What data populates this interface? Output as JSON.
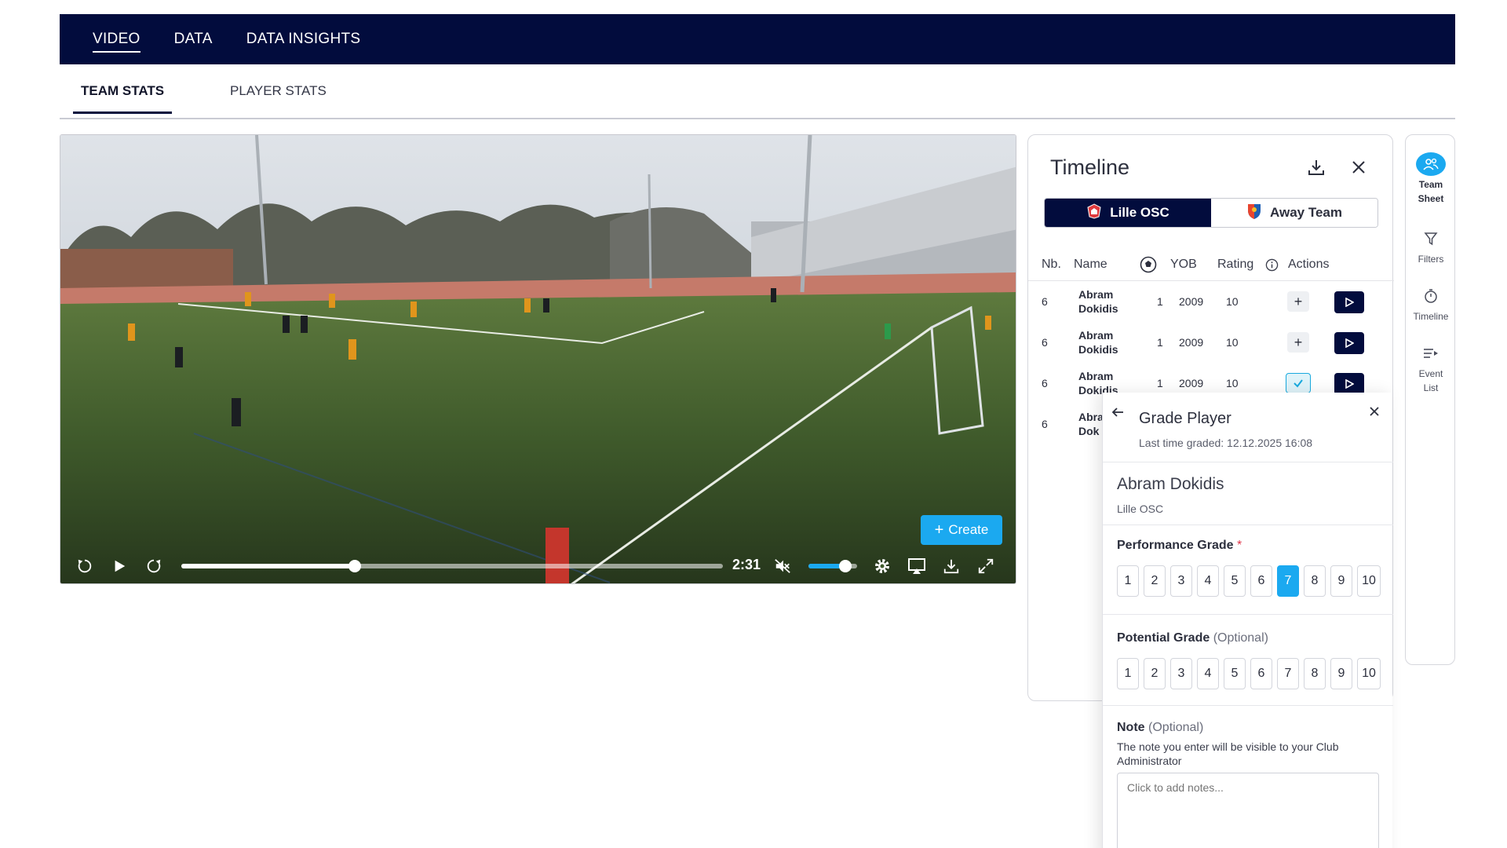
{
  "topnav": {
    "items": [
      {
        "label": "VIDEO",
        "active": true
      },
      {
        "label": "DATA",
        "active": false
      },
      {
        "label": "DATA INSIGHTS",
        "active": false
      }
    ]
  },
  "subtabs": [
    {
      "label": "TEAM STATS",
      "active": true
    },
    {
      "label": "PLAYER STATS",
      "active": false
    }
  ],
  "video": {
    "create_label": "Create",
    "time": "2:31",
    "progress_fraction": 0.32,
    "volume_fraction": 0.75,
    "muted_icon": "volume-muted-icon"
  },
  "timeline": {
    "title": "Timeline",
    "teams": [
      {
        "label": "Lille OSC",
        "active": true
      },
      {
        "label": "Away Team",
        "active": false
      }
    ],
    "headers": {
      "nb": "Nb.",
      "name": "Name",
      "yob": "YOB",
      "rating": "Rating",
      "actions": "Actions"
    },
    "rows": [
      {
        "nb": "6",
        "first": "Abram",
        "last": "Dokidis",
        "goals": "1",
        "yob": "2009",
        "rating": "10",
        "checked": false
      },
      {
        "nb": "6",
        "first": "Abram",
        "last": "Dokidis",
        "goals": "1",
        "yob": "2009",
        "rating": "10",
        "checked": false
      },
      {
        "nb": "6",
        "first": "Abram",
        "last": "Dokidis",
        "goals": "1",
        "yob": "2009",
        "rating": "10",
        "checked": true
      },
      {
        "nb": "6",
        "first": "Abra",
        "last": "Dok",
        "goals": "",
        "yob": "",
        "rating": "",
        "checked": false
      }
    ]
  },
  "rail": {
    "items": [
      {
        "line1": "Team",
        "line2": "Sheet",
        "icon": "team-sheet-icon",
        "active": true
      },
      {
        "line1": "Filters",
        "line2": "",
        "icon": "filter-icon",
        "active": false
      },
      {
        "line1": "Timeline",
        "line2": "",
        "icon": "stopwatch-icon",
        "active": false
      },
      {
        "line1": "Event",
        "line2": "List",
        "icon": "event-list-icon",
        "active": false
      }
    ]
  },
  "grade": {
    "title": "Grade Player",
    "last_graded": "Last time graded: 12.12.2025 16:08",
    "player_name": "Abram Dokidis",
    "team": "Lille OSC",
    "performance_label": "Performance Grade",
    "required_mark": "*",
    "performance_values": [
      "1",
      "2",
      "3",
      "4",
      "5",
      "6",
      "7",
      "8",
      "9",
      "10"
    ],
    "performance_selected": "7",
    "potential_label": "Potential Grade",
    "potential_optional": "(Optional)",
    "potential_values": [
      "1",
      "2",
      "3",
      "4",
      "5",
      "6",
      "7",
      "8",
      "9",
      "10"
    ],
    "note_label": "Note",
    "note_optional": "(Optional)",
    "note_help": "The note you enter will be visible to your Club Administrator",
    "note_placeholder": "Click to add notes..."
  },
  "colors": {
    "nav_bg": "#020c3d",
    "accent": "#1ba9f0"
  }
}
